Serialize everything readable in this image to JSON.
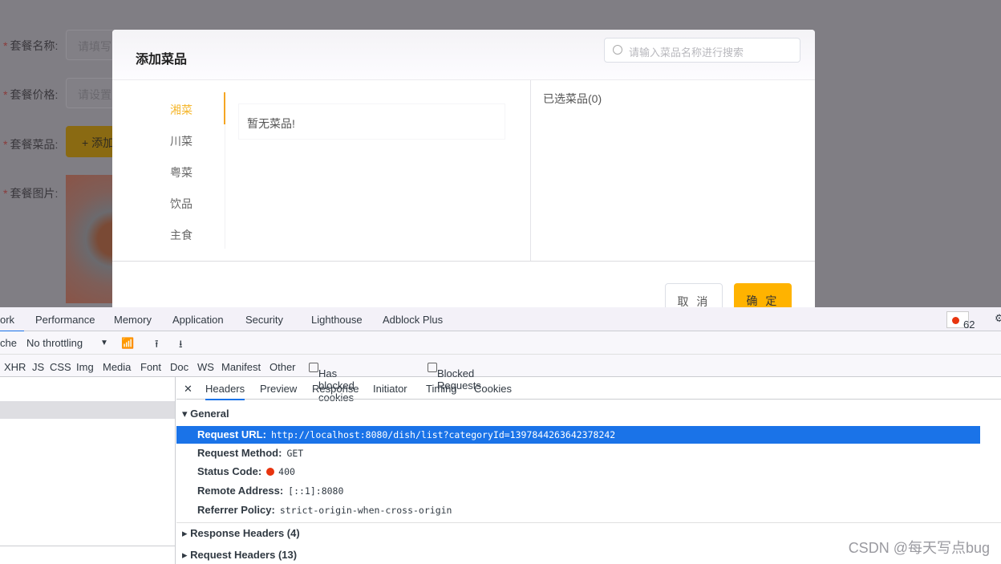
{
  "form": {
    "name_label": "套餐名称:",
    "name_placeholder": "请填写",
    "price_label": "套餐价格:",
    "price_placeholder": "请设置",
    "dishes_label": "套餐菜品:",
    "add_button": "+ 添加",
    "image_label": "套餐图片:"
  },
  "modal": {
    "title": "添加菜品",
    "search_placeholder": "请输入菜品名称进行搜索",
    "categories": [
      "湘菜",
      "川菜",
      "粤菜",
      "饮品",
      "主食"
    ],
    "active_category": "湘菜",
    "empty_text": "暂无菜品!",
    "selected_label": "已选菜品(0)",
    "cancel": "取 消",
    "confirm": "确 定",
    "accent": "#ffb300"
  },
  "devtools": {
    "tabs": [
      "ork",
      "Performance",
      "Memory",
      "Application",
      "Security",
      "Lighthouse",
      "Adblock Plus"
    ],
    "error_count": "62",
    "toolbar": {
      "cache": "che",
      "throttling": "No throttling"
    },
    "filters": [
      "XHR",
      "JS",
      "CSS",
      "Img",
      "Media",
      "Font",
      "Doc",
      "WS",
      "Manifest",
      "Other"
    ],
    "has_blocked_cookies": "Has blocked cookies",
    "blocked_requests": "Blocked Requests",
    "detail_tabs": [
      "Headers",
      "Preview",
      "Response",
      "Initiator",
      "Timing",
      "Cookies"
    ],
    "general": "General",
    "rows": [
      {
        "k": "Request URL:",
        "v": "http://localhost:8080/dish/list?categoryId=1397844263642378242"
      },
      {
        "k": "Request Method:",
        "v": "GET"
      },
      {
        "k": "Status Code:",
        "v": "400"
      },
      {
        "k": "Remote Address:",
        "v": "[::1]:8080"
      },
      {
        "k": "Referrer Policy:",
        "v": "strict-origin-when-cross-origin"
      }
    ],
    "response_headers": "Response Headers (4)",
    "request_headers": "Request Headers (13)"
  },
  "watermark": "CSDN @每天写点bug"
}
